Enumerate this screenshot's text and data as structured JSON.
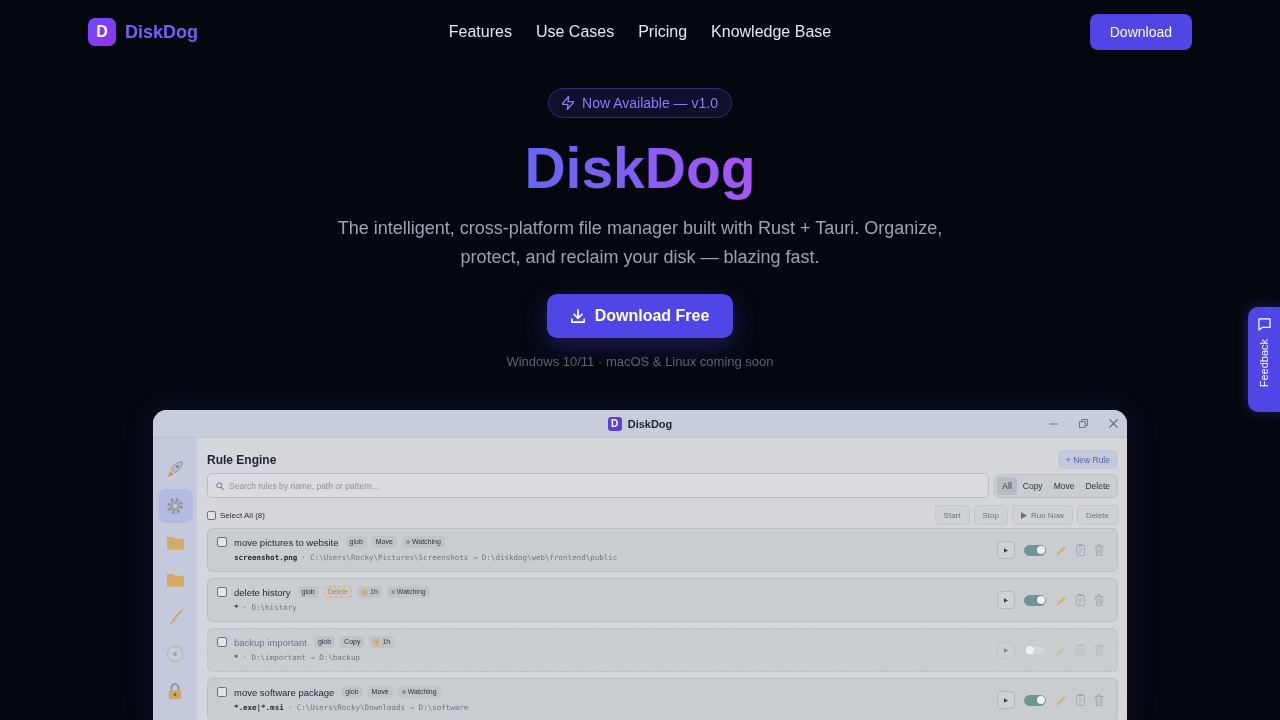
{
  "nav": {
    "logo_letter": "D",
    "brand": "DiskDog",
    "links": [
      "Features",
      "Use Cases",
      "Pricing",
      "Knowledge Base"
    ],
    "cta": "Download"
  },
  "hero": {
    "badge": "Now Available — v1.0",
    "title": "DiskDog",
    "subtitle": "The intelligent, cross-platform file manager built with Rust + Tauri. Organize, protect, and reclaim your disk — blazing fast.",
    "button": "Download Free",
    "note": "Windows 10/11 · macOS & Linux coming soon"
  },
  "app_window": {
    "logo_letter": "D",
    "title": "DiskDog",
    "sidebar_items": [
      {
        "kind": "rocket",
        "selected": false
      },
      {
        "kind": "gear",
        "selected": true
      },
      {
        "kind": "folder",
        "selected": false
      },
      {
        "kind": "folder",
        "selected": false
      },
      {
        "kind": "brush",
        "selected": false
      },
      {
        "kind": "disc",
        "selected": false
      },
      {
        "kind": "lock",
        "selected": false
      }
    ],
    "heading": "Rule Engine",
    "new_rule": "+ New Rule",
    "search": {
      "placeholder": "Search rules by name, path or pattern..."
    },
    "filters": [
      {
        "label": "All",
        "selected": true
      },
      {
        "label": "Copy",
        "selected": false
      },
      {
        "label": "Move",
        "selected": false
      },
      {
        "label": "Delete",
        "selected": false
      }
    ],
    "select_all": {
      "label": "Select All (8)",
      "checked": false
    },
    "actions": [
      {
        "label": "Start",
        "kind": "plain"
      },
      {
        "label": "Stop",
        "kind": "plain"
      },
      {
        "label": "Run Now",
        "kind": "play"
      },
      {
        "label": "Delete",
        "kind": "plain"
      }
    ],
    "rules": [
      {
        "name": "move pictures to website",
        "checked": false,
        "enabled": true,
        "tags": [
          {
            "text": "glob",
            "kind": "type"
          },
          {
            "text": "Move",
            "kind": "action"
          },
          {
            "text": "Watching",
            "kind": "watching"
          }
        ],
        "pattern": "screenshot.png",
        "location": "· C:\\Users\\Rocky\\Pictures\\Screenshots → D:\\diskdog\\web\\frontend\\public"
      },
      {
        "name": "delete history",
        "checked": false,
        "enabled": true,
        "tags": [
          {
            "text": "glob",
            "kind": "type"
          },
          {
            "text": "Delete",
            "kind": "danger"
          },
          {
            "text": "1h",
            "kind": "schedule"
          },
          {
            "text": "Watching",
            "kind": "watching"
          }
        ],
        "pattern": "*",
        "location": "· D:\\history"
      },
      {
        "name": "backup important",
        "checked": false,
        "enabled": false,
        "tags": [
          {
            "text": "glob",
            "kind": "type"
          },
          {
            "text": "Copy",
            "kind": "action"
          },
          {
            "text": "1h",
            "kind": "schedule"
          }
        ],
        "pattern": "*",
        "location": "· D:\\important → D:\\backup"
      },
      {
        "name": "move software package",
        "checked": false,
        "enabled": true,
        "tags": [
          {
            "text": "glob",
            "kind": "type"
          },
          {
            "text": "Move",
            "kind": "action"
          },
          {
            "text": "Watching",
            "kind": "watching"
          }
        ],
        "pattern": "*.exe|*.msi",
        "location": "· C:\\Users\\Rocky\\Downloads → D:\\software"
      }
    ]
  },
  "feedback_tab": {
    "label": "Feedback"
  }
}
